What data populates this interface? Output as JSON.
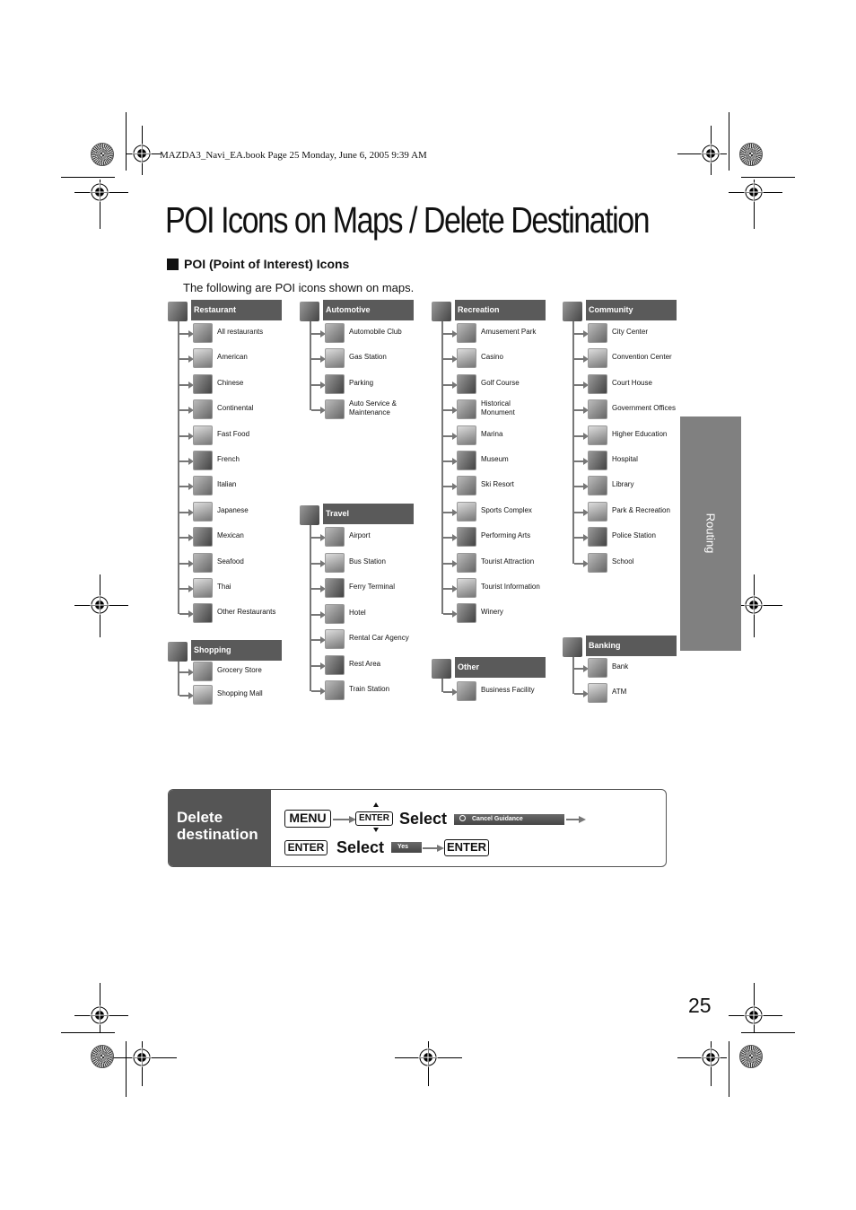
{
  "print_header": "MAZDA3_Navi_EA.book  Page 25  Monday, June 6, 2005  9:39 AM",
  "page_title": "POI Icons on Maps / Delete Destination",
  "section": {
    "heading": "POI (Point of Interest) Icons",
    "intro": "The following are POI icons shown on maps."
  },
  "categories": {
    "restaurant": {
      "label": "Restaurant",
      "icon": "fork-knife-icon",
      "items": [
        "All restaurants",
        "American",
        "Chinese",
        "Continental",
        "Fast Food",
        "French",
        "Italian",
        "Japanese",
        "Mexican",
        "Seafood",
        "Thai",
        "Other Restaurants"
      ]
    },
    "shopping": {
      "label": "Shopping",
      "icon": "shopping-bag-icon",
      "items": [
        "Grocery Store",
        "Shopping Mall"
      ]
    },
    "automotive": {
      "label": "Automotive",
      "icon": "car-icon",
      "items": [
        "Automobile Club",
        "Gas Station",
        "Parking",
        "Auto Service & Maintenance"
      ]
    },
    "travel": {
      "label": "Travel",
      "icon": "luggage-icon",
      "items": [
        "Airport",
        "Bus Station",
        "Ferry Terminal",
        "Hotel",
        "Rental Car Agency",
        "Rest Area",
        "Train Station"
      ]
    },
    "recreation": {
      "label": "Recreation",
      "icon": "smiley-icon",
      "items": [
        "Amusement Park",
        "Casino",
        "Golf Course",
        "Historical Monument",
        "Marina",
        "Museum",
        "Ski Resort",
        "Sports Complex",
        "Performing Arts",
        "Tourist Attraction",
        "Tourist Information",
        "Winery"
      ]
    },
    "other": {
      "label": "Other",
      "icon": "etc-icon",
      "items": [
        "Business Facility"
      ]
    },
    "community": {
      "label": "Community",
      "icon": "community-icon",
      "items": [
        "City Center",
        "Convention Center",
        "Court House",
        "Government Offices",
        "Higher Education",
        "Hospital",
        "Library",
        "Park & Recreation",
        "Police Station",
        "School"
      ]
    },
    "banking": {
      "label": "Banking",
      "icon": "dollar-icon",
      "items": [
        "Bank",
        "ATM"
      ]
    }
  },
  "side_tab": "Routing",
  "delete_destination": {
    "label": "Delete destination",
    "menu_key": "MENU",
    "enter_key": "ENTER",
    "select_word": "Select",
    "cancel_button": "Cancel Guidance",
    "yes_button": "Yes"
  },
  "page_number": "25"
}
